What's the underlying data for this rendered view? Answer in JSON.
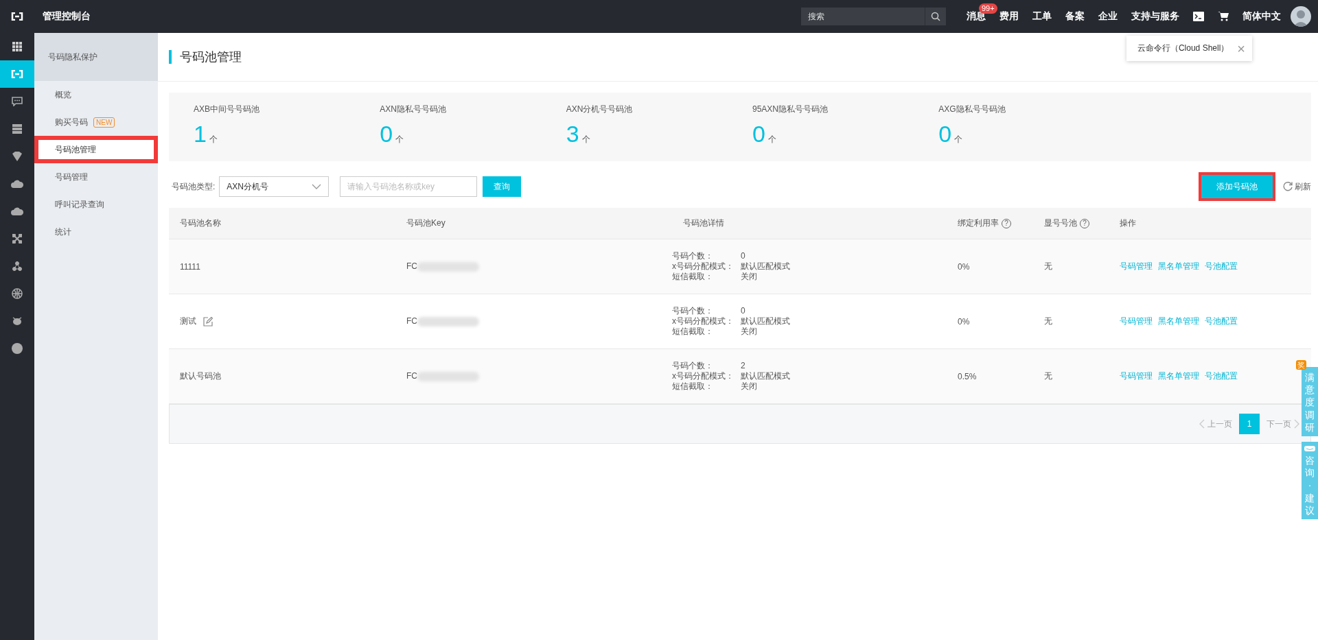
{
  "topbar": {
    "title": "管理控制台",
    "search": {
      "placeholder": "搜索"
    },
    "nav": [
      {
        "label": "消息",
        "badge": "99+"
      },
      {
        "label": "费用"
      },
      {
        "label": "工单"
      },
      {
        "label": "备案"
      },
      {
        "label": "企业"
      },
      {
        "label": "支持与服务"
      }
    ],
    "language": "简体中文"
  },
  "tooltip": {
    "text": "云命令行（Cloud Shell）",
    "close": "×"
  },
  "rail": [
    {
      "kind": "grid",
      "selected": false
    },
    {
      "kind": "logo",
      "selected": true
    },
    {
      "kind": "chat",
      "selected": false
    },
    {
      "kind": "server",
      "selected": false
    },
    {
      "kind": "shield",
      "selected": false
    },
    {
      "kind": "cloud",
      "selected": false
    },
    {
      "kind": "cloud",
      "selected": false
    },
    {
      "kind": "network",
      "selected": false
    },
    {
      "kind": "nodes",
      "selected": false
    },
    {
      "kind": "globe",
      "selected": false
    },
    {
      "kind": "bug",
      "selected": false
    },
    {
      "kind": "dot",
      "selected": false
    }
  ],
  "sidebar": {
    "title": "号码隐私保护",
    "items": [
      {
        "label": "概览",
        "selected": false,
        "highlighted": false
      },
      {
        "label": "购买号码",
        "badge": "NEW",
        "selected": false,
        "highlighted": false
      },
      {
        "label": "号码池管理",
        "selected": true,
        "highlighted": true
      },
      {
        "label": "号码管理",
        "selected": false,
        "highlighted": false
      },
      {
        "label": "呼叫记录查询",
        "selected": false,
        "highlighted": false
      },
      {
        "label": "统计",
        "selected": false,
        "highlighted": false
      }
    ]
  },
  "page_title": "号码池管理",
  "stats": [
    {
      "label": "AXB中间号号码池",
      "value": "1",
      "unit": "个"
    },
    {
      "label": "AXN隐私号号码池",
      "value": "0",
      "unit": "个"
    },
    {
      "label": "AXN分机号号码池",
      "value": "3",
      "unit": "个"
    },
    {
      "label": "95AXN隐私号号码池",
      "value": "0",
      "unit": "个"
    },
    {
      "label": "AXG隐私号号码池",
      "value": "0",
      "unit": "个"
    }
  ],
  "filter": {
    "label": "号码池类型:",
    "select": "AXN分机号",
    "search": {
      "placeholder": "请输入号码池名称或key"
    },
    "query_button": "查询",
    "add_button": {
      "label": "添加号码池",
      "highlighted": true
    },
    "refresh": "刷新"
  },
  "table": {
    "columns": [
      {
        "label": "号码池名称"
      },
      {
        "label": "号码池Key"
      },
      {
        "label": "号码池详情"
      },
      {
        "label": "绑定利用率",
        "help": "?"
      },
      {
        "label": "显号号池",
        "help": "?"
      },
      {
        "label": "操作"
      }
    ],
    "rows": [
      {
        "name": "11111",
        "editable": false,
        "key": "FC",
        "details": [
          [
            "号码个数：",
            "0"
          ],
          [
            "x号码分配模式：",
            "默认匹配模式"
          ],
          [
            "短信截取：",
            "关闭"
          ]
        ],
        "usage": "0%",
        "display_pool": "无",
        "actions": [
          "号码管理",
          "黑名单管理",
          "号池配置"
        ]
      },
      {
        "name": "测试",
        "editable": true,
        "key": "FC",
        "details": [
          [
            "号码个数：",
            "0"
          ],
          [
            "x号码分配模式：",
            "默认匹配模式"
          ],
          [
            "短信截取：",
            "关闭"
          ]
        ],
        "usage": "0%",
        "display_pool": "无",
        "actions": [
          "号码管理",
          "黑名单管理",
          "号池配置"
        ]
      },
      {
        "name": "默认号码池",
        "editable": false,
        "key": "FC",
        "details": [
          [
            "号码个数：",
            "2"
          ],
          [
            "x号码分配模式：",
            "默认匹配模式"
          ],
          [
            "短信截取：",
            "关闭"
          ]
        ],
        "usage": "0.5%",
        "display_pool": "无",
        "actions": [
          "号码管理",
          "黑名单管理",
          "号池配置"
        ]
      }
    ]
  },
  "pagination": {
    "prev": "上一页",
    "pages": [
      {
        "label": "1",
        "selected": true
      }
    ],
    "next": "下一页"
  },
  "float_tabs": [
    {
      "text": "满意度调研",
      "badge": "奖",
      "icon": false
    },
    {
      "text": "咨询·建议",
      "icon": true
    }
  ]
}
